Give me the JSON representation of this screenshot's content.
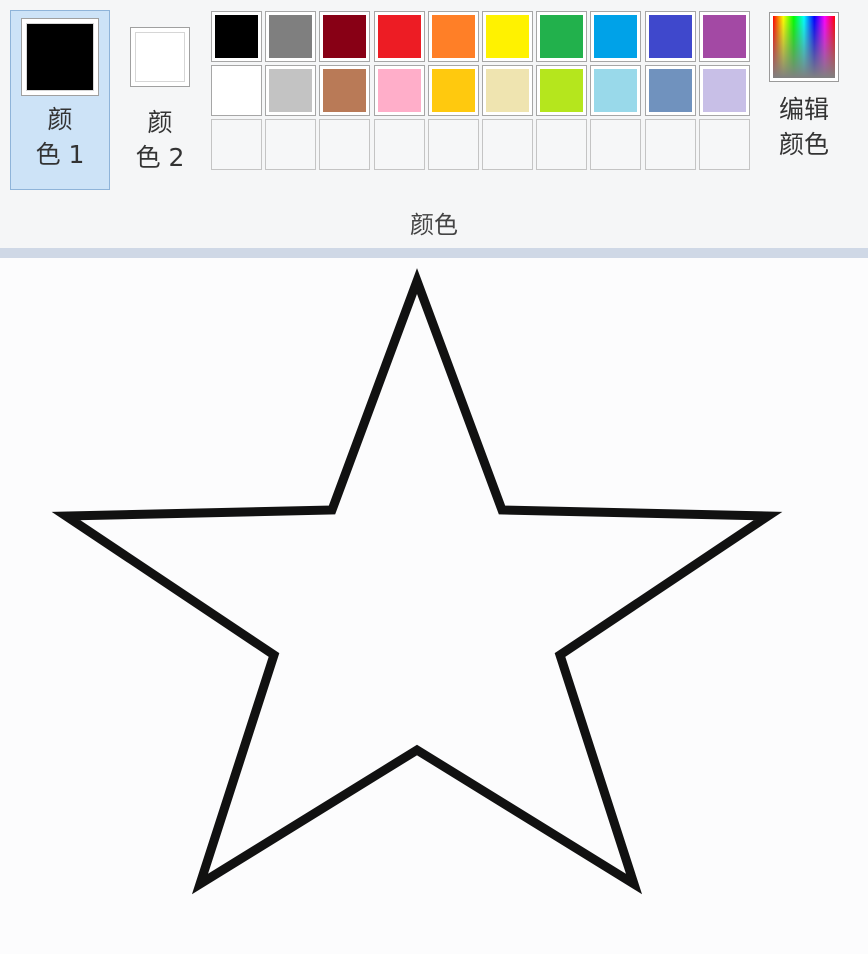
{
  "ribbon": {
    "color1": {
      "label": "颜\n色 1",
      "color": "#000000",
      "selected": true
    },
    "color2": {
      "label": "颜\n色 2",
      "color": "#ffffff"
    },
    "palette": {
      "row1": [
        "#000000",
        "#7f7f7f",
        "#880015",
        "#ed1c24",
        "#ff7f27",
        "#fff200",
        "#22b14c",
        "#00a2e8",
        "#3f48cc",
        "#a349a4"
      ],
      "row2": [
        "#ffffff",
        "#c3c3c3",
        "#b97a57",
        "#ffaec9",
        "#ffc90e",
        "#efe4b0",
        "#b5e61d",
        "#99d9ea",
        "#7092be",
        "#c8bfe7"
      ],
      "row3_empty_count": 10
    },
    "edit_colors": {
      "label": "编辑\n颜色",
      "icon": "rainbow-spectrum-icon"
    },
    "group_label": "颜色"
  },
  "canvas": {
    "background": "#fcfcfd",
    "drawing": {
      "shape": "star",
      "points": 5,
      "stroke_color": "#111111",
      "fill": "none"
    }
  }
}
